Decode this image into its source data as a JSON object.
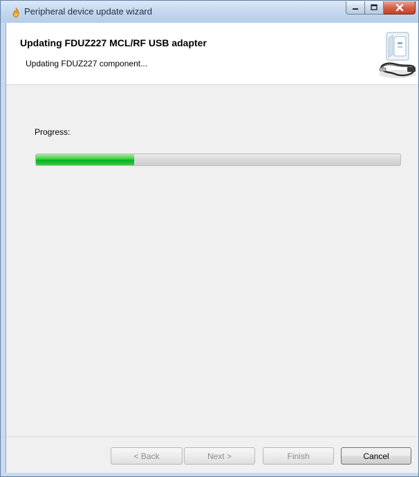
{
  "window": {
    "title": "Peripheral device update wizard",
    "app_icon": "flame-app-icon"
  },
  "caption_buttons": {
    "minimize_icon": "minimize-icon",
    "maximize_icon": "maximize-icon",
    "close_icon": "close-icon"
  },
  "header": {
    "title": "Updating FDUZ227 MCL/RF USB adapter",
    "subtitle": "Updating FDUZ227 component...",
    "image_icon": "usb-adapter-device-icon"
  },
  "progress": {
    "label": "Progress:",
    "fraction": 0.27,
    "fill_color": "#06b025"
  },
  "buttons": {
    "back": {
      "label": "< Back",
      "enabled": false
    },
    "next": {
      "label": "Next >",
      "enabled": false
    },
    "finish": {
      "label": "Finish",
      "enabled": false
    },
    "cancel": {
      "label": "Cancel",
      "enabled": true
    }
  }
}
